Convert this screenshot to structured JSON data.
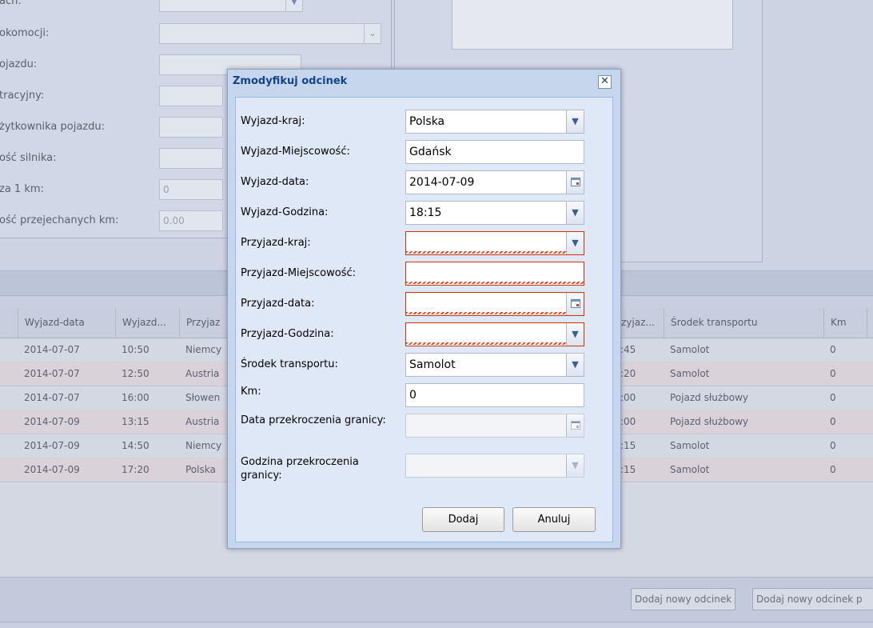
{
  "form_labels": [
    "ach:",
    "okomocji:",
    "ojazdu:",
    "tracyjny:",
    "żytkownika pojazdu:",
    "ość silnika:",
    "za 1 km:",
    "ość przejechanych km:"
  ],
  "form_values": {
    "rate": "0",
    "km_total": "0.00"
  },
  "grid": {
    "columns": [
      "Wyjazd-data",
      "Wyjazd...",
      "Przyjaz",
      "zyjaz...",
      "Środek transportu",
      "Km"
    ],
    "rows": [
      [
        "2014-07-07",
        "10:50",
        "Niemcy",
        ":45",
        "Samolot",
        "0"
      ],
      [
        "2014-07-07",
        "12:50",
        "Austria",
        ":20",
        "Samolot",
        "0"
      ],
      [
        "2014-07-07",
        "16:00",
        "Słowen",
        ":00",
        "Pojazd służbowy",
        "0"
      ],
      [
        "2014-07-09",
        "13:15",
        "Austria",
        ":00",
        "Pojazd służbowy",
        "0"
      ],
      [
        "2014-07-09",
        "14:50",
        "Niemcy",
        ":15",
        "Samolot",
        "0"
      ],
      [
        "2014-07-09",
        "17:20",
        "Polska",
        ":15",
        "Samolot",
        "0"
      ]
    ]
  },
  "bottom_bar": {
    "add_segment": "Dodaj nowy odcinek",
    "add_segment_2": "Dodaj nowy odcinek p"
  },
  "modal": {
    "title": "Zmodyfikuj odcinek",
    "close": "✕",
    "fields": {
      "departure_country": {
        "label": "Wyjazd-kraj:",
        "value": "Polska"
      },
      "departure_city": {
        "label": "Wyjazd-Miejscowość:",
        "value": "Gdańsk"
      },
      "departure_date": {
        "label": "Wyjazd-data:",
        "value": "2014-07-09"
      },
      "departure_time": {
        "label": "Wyjazd-Godzina:",
        "value": "18:15"
      },
      "arrival_country": {
        "label": "Przyjazd-kraj:",
        "value": ""
      },
      "arrival_city": {
        "label": "Przyjazd-Miejscowość:",
        "value": ""
      },
      "arrival_date": {
        "label": "Przyjazd-data:",
        "value": ""
      },
      "arrival_time": {
        "label": "Przyjazd-Godzina:",
        "value": ""
      },
      "transport": {
        "label": "Środek transportu:",
        "value": "Samolot"
      },
      "km": {
        "label": "Km:",
        "value": "0"
      },
      "border_date": {
        "label": "Data przekroczenia granicy:",
        "value": ""
      },
      "border_time": {
        "label": "Godzina przekroczenia granicy:",
        "value": ""
      }
    },
    "buttons": {
      "add": "Dodaj",
      "cancel": "Anuluj"
    }
  },
  "icons": {
    "dropdown": "chevron-down-icon",
    "calendar": "calendar-icon",
    "close": "close-icon"
  },
  "colors": {
    "modal_title": "#15428b",
    "invalid": "#cc3300",
    "modal_body": "#dfe8f6"
  }
}
